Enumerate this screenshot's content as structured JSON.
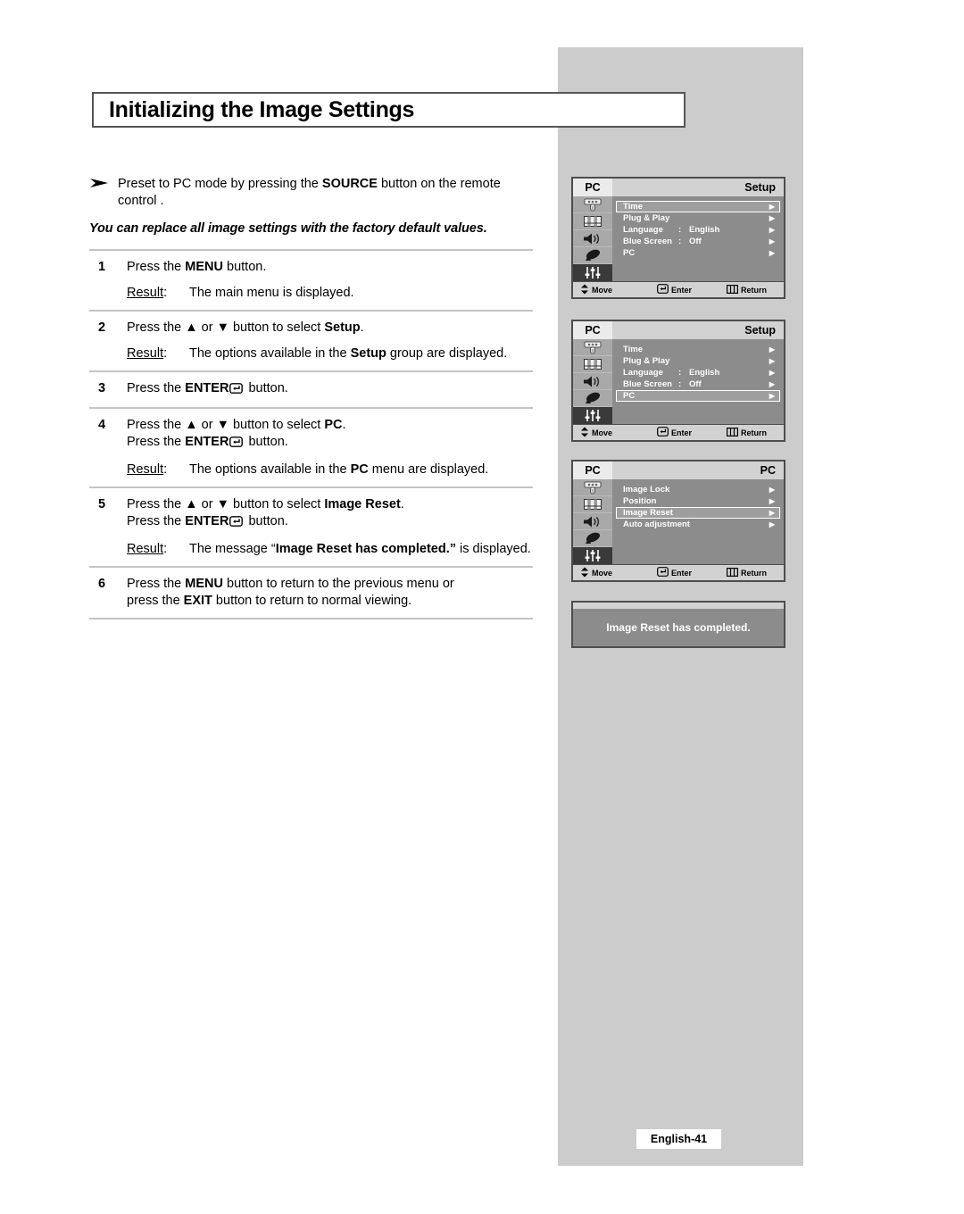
{
  "page": {
    "title": "Initializing the Image Settings",
    "footer_label": "English-41"
  },
  "note": {
    "icon": "arrow-bullet-icon",
    "text_before_bold": "Preset to PC mode by pressing the ",
    "bold": "SOURCE",
    "text_after_bold": " button on the remote control ."
  },
  "lead_in": "You can replace all image settings with the factory default values.",
  "steps": [
    {
      "number": "1",
      "lines": [
        {
          "pre": "Press the ",
          "bold": "MENU",
          "post": " button."
        }
      ],
      "result_label": "Result:",
      "result": [
        {
          "pre": "The main menu is displayed.",
          "bold": "",
          "post": ""
        }
      ]
    },
    {
      "number": "2",
      "lines": [
        {
          "pre": "Press the ▲ or ▼ button to select ",
          "bold": "Setup",
          "post": "."
        }
      ],
      "result_label": "Result:",
      "result": [
        {
          "pre": "The options available in the ",
          "bold": "Setup",
          "post": " group are displayed."
        }
      ]
    },
    {
      "number": "3",
      "lines": [
        {
          "pre": "Press the ",
          "bold": "ENTER",
          "post": " button.",
          "enter_glyph": true
        }
      ],
      "result_label": "",
      "result": []
    },
    {
      "number": "4",
      "lines": [
        {
          "pre": "Press the ▲ or ▼ button to select ",
          "bold": "PC",
          "post": "."
        },
        {
          "pre": "Press the ",
          "bold": "ENTER",
          "post": " button.",
          "enter_glyph": true
        }
      ],
      "result_label": "Result:",
      "result": [
        {
          "pre": "The options available in the ",
          "bold": "PC",
          "post": " menu are displayed."
        }
      ]
    },
    {
      "number": "5",
      "lines": [
        {
          "pre": "Press the ▲ or ▼ button to select ",
          "bold": "Image Reset",
          "post": "."
        },
        {
          "pre": "Press the ",
          "bold": "ENTER",
          "post": " button.",
          "enter_glyph": true
        }
      ],
      "result_label": "Result:",
      "result": [
        {
          "pre": "The message “",
          "bold": "Image Reset has completed.”",
          "post": " is displayed."
        }
      ]
    },
    {
      "number": "6",
      "lines": [
        {
          "pre": "Press the ",
          "bold": "MENU",
          "post": " button to return to the previous menu or"
        },
        {
          "pre": "press the ",
          "bold": "EXIT",
          "post": " button to return to normal viewing."
        }
      ],
      "result_label": "",
      "result": []
    }
  ],
  "osd_common": {
    "rail_icons": [
      "input-source-icon",
      "picture-icon",
      "sound-icon",
      "channel-dish-icon",
      "setup-sliders-icon"
    ],
    "active_rail_index": 4,
    "footer": {
      "move": "Move",
      "enter": "Enter",
      "return": "Return",
      "move_icon": "up-down-arrows-icon",
      "enter_icon": "enter-key-icon",
      "return_icon": "menu-return-icon"
    },
    "colors": {
      "body": "#8c8c8c",
      "rail": "#a8a8a8",
      "rail_active": "#3a3a3a",
      "header": "#d2d2d2",
      "header_left": "#ebebeb",
      "border": "#4d4d4d",
      "highlight": "#9e9e9e",
      "panel_bg": "#cccccc"
    }
  },
  "osd_menus": [
    {
      "name": "setup-menu-time-selected",
      "header_left": "PC",
      "header_right": "Setup",
      "items": [
        {
          "label": "Time",
          "colon": "",
          "value": "",
          "arrow": "▶",
          "selected": true
        },
        {
          "label": "Plug & Play",
          "colon": "",
          "value": "",
          "arrow": "▶",
          "selected": false
        },
        {
          "label": "Language",
          "colon": ":",
          "value": "English",
          "arrow": "▶",
          "selected": false
        },
        {
          "label": "Blue Screen",
          "colon": ":",
          "value": "Off",
          "arrow": "▶",
          "selected": false
        },
        {
          "label": "PC",
          "colon": "",
          "value": "",
          "arrow": "▶",
          "selected": false
        }
      ]
    },
    {
      "name": "setup-menu-pc-selected",
      "header_left": "PC",
      "header_right": "Setup",
      "items": [
        {
          "label": "Time",
          "colon": "",
          "value": "",
          "arrow": "▶",
          "selected": false
        },
        {
          "label": "Plug & Play",
          "colon": "",
          "value": "",
          "arrow": "▶",
          "selected": false
        },
        {
          "label": "Language",
          "colon": ":",
          "value": "English",
          "arrow": "▶",
          "selected": false
        },
        {
          "label": "Blue Screen",
          "colon": ":",
          "value": "Off",
          "arrow": "▶",
          "selected": false
        },
        {
          "label": "PC",
          "colon": "",
          "value": "",
          "arrow": "▶",
          "selected": true
        }
      ]
    },
    {
      "name": "pc-menu-image-reset-selected",
      "header_left": "PC",
      "header_right": "PC",
      "items": [
        {
          "label": "Image Lock",
          "colon": "",
          "value": "",
          "arrow": "▶",
          "selected": false
        },
        {
          "label": "Position",
          "colon": "",
          "value": "",
          "arrow": "▶",
          "selected": false
        },
        {
          "label": "Image Reset",
          "colon": "",
          "value": "",
          "arrow": "▶",
          "selected": true
        },
        {
          "label": "Auto adjustment",
          "colon": "",
          "value": "",
          "arrow": "▶",
          "selected": false
        }
      ]
    }
  ],
  "osd_message": {
    "name": "image-reset-completed-message",
    "text": "Image Reset has completed."
  }
}
